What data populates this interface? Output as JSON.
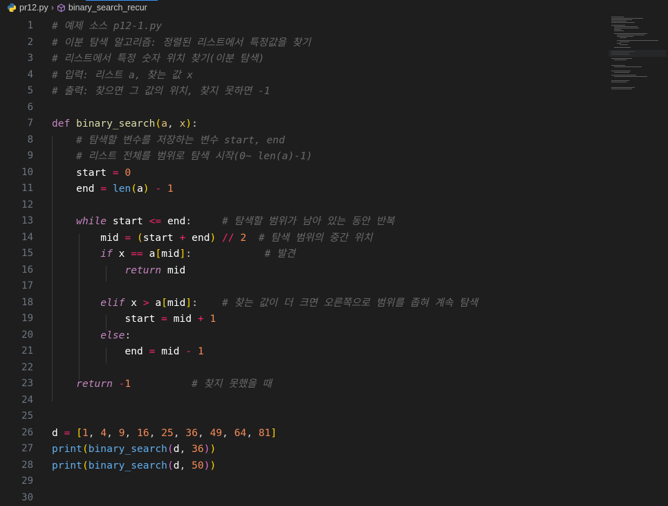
{
  "breadcrumb": {
    "file": "pr12.py",
    "symbol": "binary_search_recur"
  },
  "lines": [
    {
      "n": "1",
      "t": "# 예제 소스 p12-1.py"
    },
    {
      "n": "2",
      "t": "# 이분 탐색 알고리즘: 정렬된 리스트에서 특정값을 찾기"
    },
    {
      "n": "3",
      "t": "# 리스트에서 특정 숫자 위치 찾기(이분 탐색)"
    },
    {
      "n": "4",
      "t": "# 입력: 리스트 a, 찾는 값 x"
    },
    {
      "n": "5",
      "t": "# 출력: 찾으면 그 값의 위치, 찾지 못하면 -1"
    },
    {
      "n": "6",
      "t": ""
    },
    {
      "n": "7",
      "t": "def binary_search(a, x):"
    },
    {
      "n": "8",
      "t": "    # 탐색할 변수를 저장하는 변수 start, end"
    },
    {
      "n": "9",
      "t": "    # 리스트 전체를 범위로 탐색 시작(0~ len(a)-1)"
    },
    {
      "n": "10",
      "t": "    start = 0"
    },
    {
      "n": "11",
      "t": "    end = len(a) - 1"
    },
    {
      "n": "12",
      "t": ""
    },
    {
      "n": "13",
      "t": "    while start <= end:     # 탐색할 범위가 남아 있는 동안 반복"
    },
    {
      "n": "14",
      "t": "        mid = (start + end) // 2  # 탐색 범위의 중간 위치"
    },
    {
      "n": "15",
      "t": "        if x == a[mid]:            # 발견"
    },
    {
      "n": "16",
      "t": "            return mid"
    },
    {
      "n": "17",
      "t": ""
    },
    {
      "n": "18",
      "t": "        elif x > a[mid]:    # 찾는 값이 더 크면 오른쪽으로 범위를 좁혀 계속 탐색"
    },
    {
      "n": "19",
      "t": "            start = mid + 1"
    },
    {
      "n": "20",
      "t": "        else:"
    },
    {
      "n": "21",
      "t": "            end = mid - 1"
    },
    {
      "n": "22",
      "t": ""
    },
    {
      "n": "23",
      "t": "    return -1          # 찾지 못했을 때"
    },
    {
      "n": "24",
      "t": ""
    },
    {
      "n": "25",
      "t": ""
    },
    {
      "n": "26",
      "t": "d = [1, 4, 9, 16, 25, 36, 49, 64, 81]"
    },
    {
      "n": "27",
      "t": "print(binary_search(d, 36))"
    },
    {
      "n": "28",
      "t": "print(binary_search(d, 50))"
    },
    {
      "n": "29",
      "t": ""
    },
    {
      "n": "30",
      "t": ""
    }
  ],
  "colors": {
    "background": "#1e1e1e",
    "comment": "#6a6a6a",
    "keyword": "#c586c0",
    "number": "#f58b57",
    "function": "#dcdcaa"
  }
}
